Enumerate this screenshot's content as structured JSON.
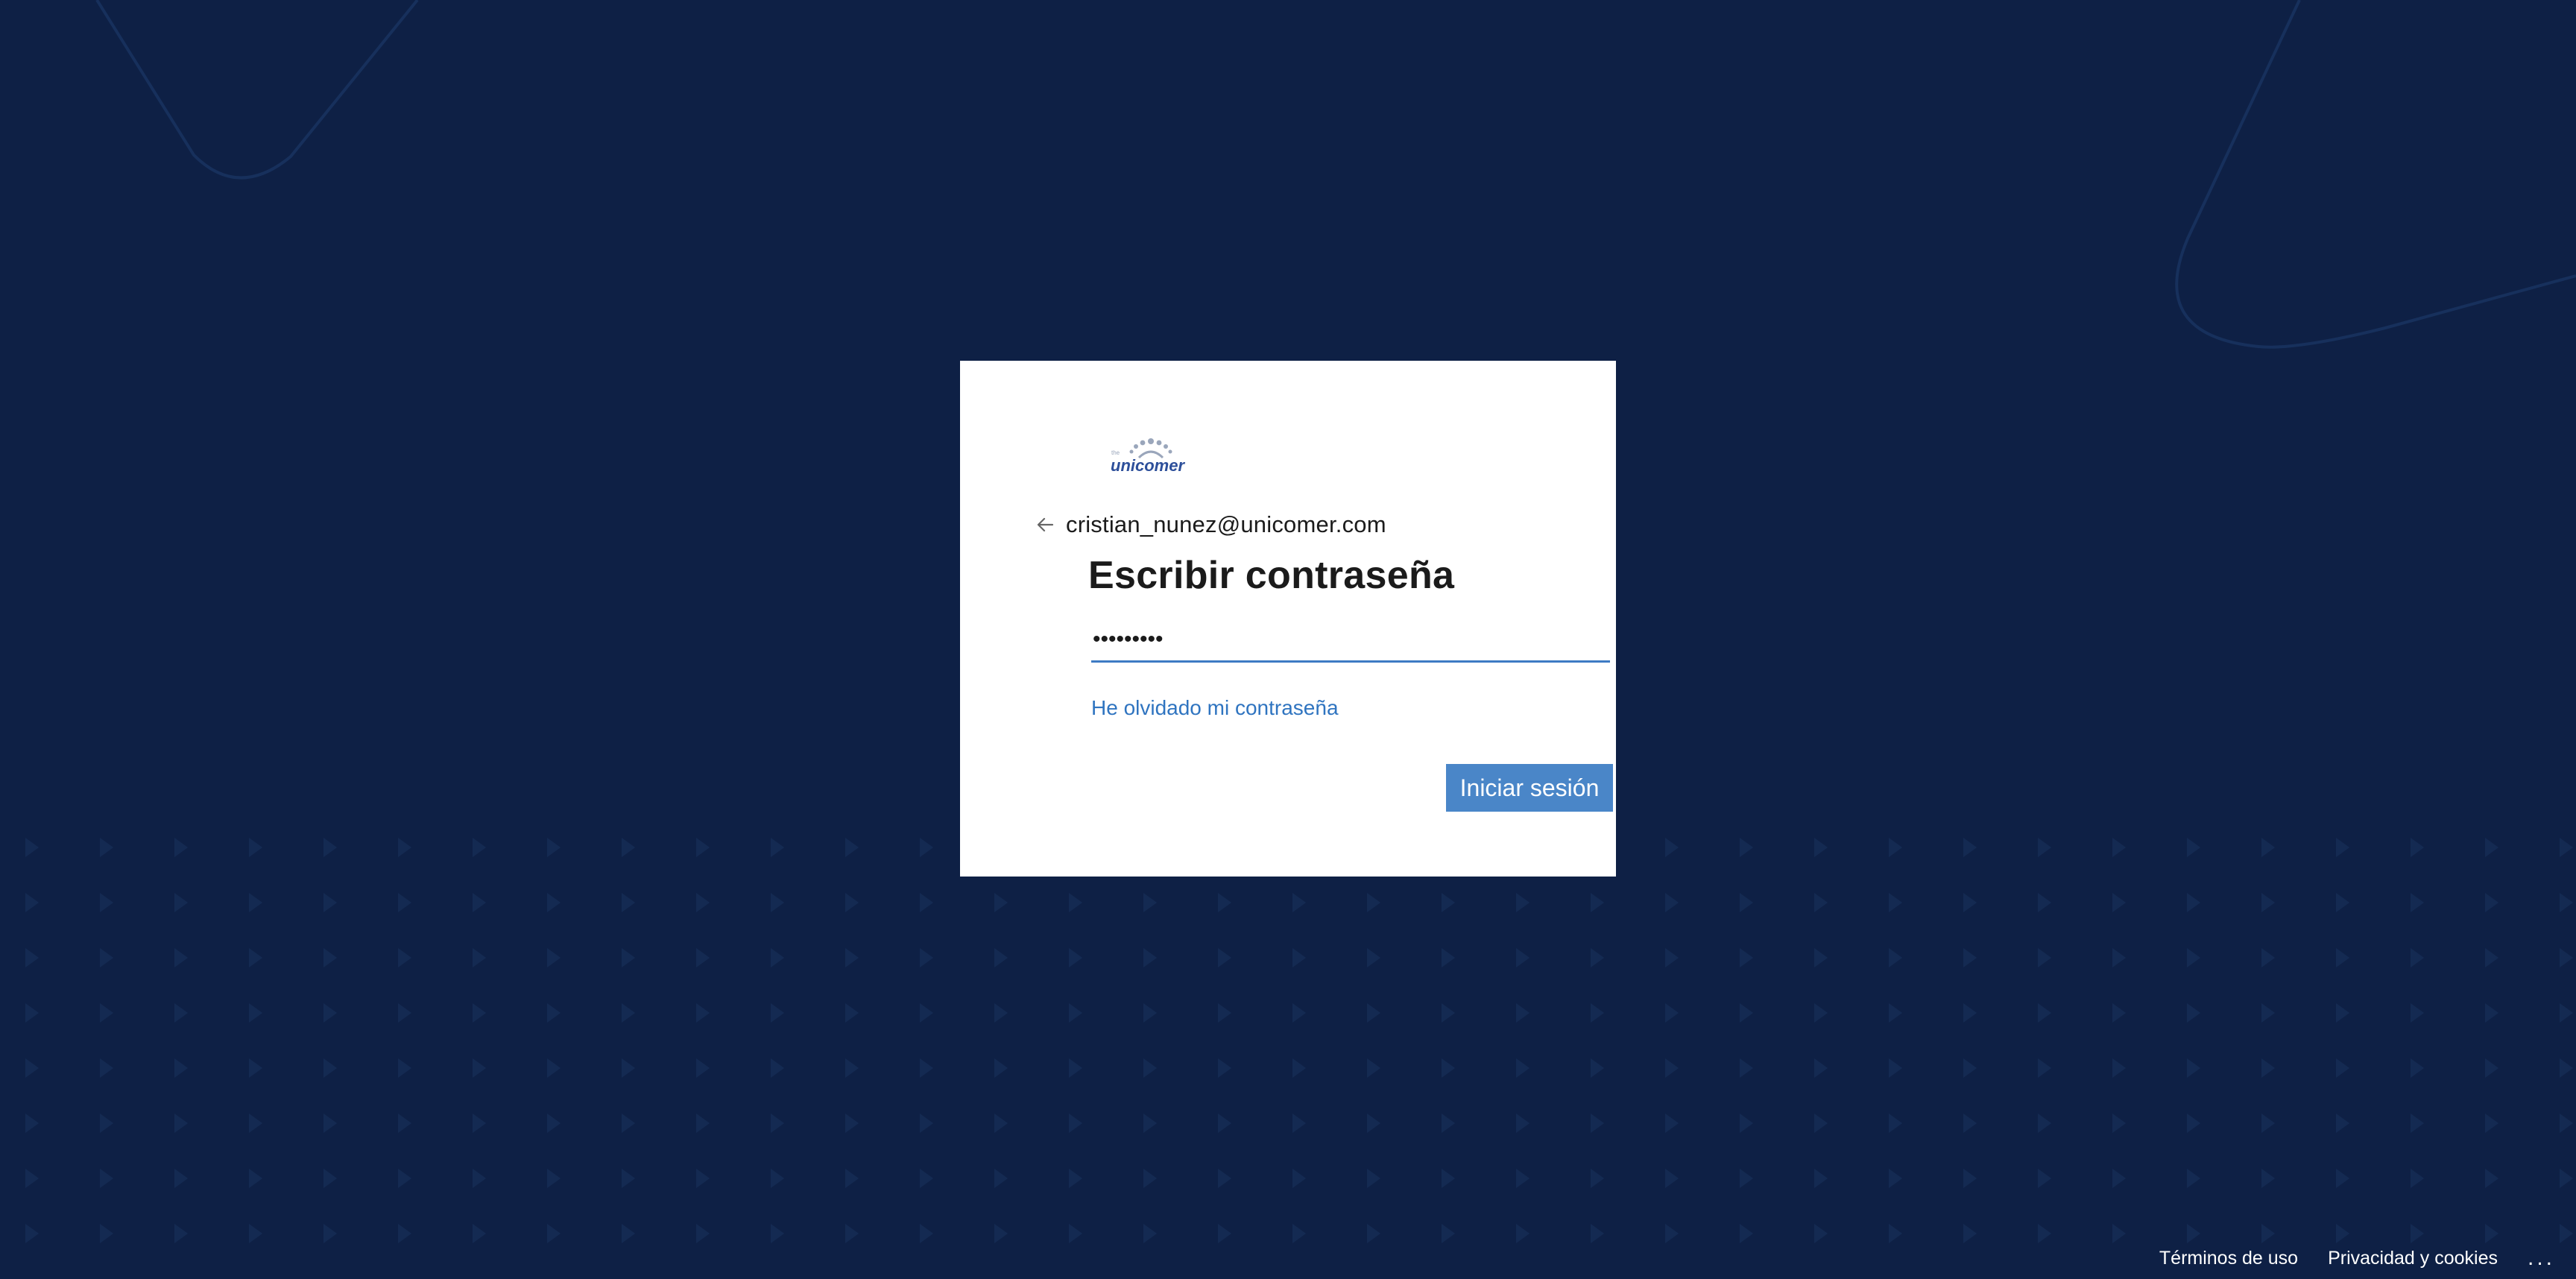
{
  "background": {
    "color": "#0e2045",
    "pattern_color": "#13284f",
    "shape": "triangle-grid"
  },
  "brand": {
    "logo_name": "unicomer-logo",
    "logo_text": "unicomer",
    "logo_color": "#2d4f9a"
  },
  "signin": {
    "back_icon": "arrow-left-icon",
    "identity": "cristian_nunez@unicomer.com",
    "title": "Escribir contraseña",
    "password_value": "•••••••••",
    "forgot_link": "He olvidado mi contraseña",
    "submit_label": "Iniciar sesión",
    "accent_color": "#4a86c8",
    "link_color": "#2f74c0"
  },
  "footer": {
    "terms": "Términos de uso",
    "privacy": "Privacidad y cookies",
    "more": "..."
  }
}
